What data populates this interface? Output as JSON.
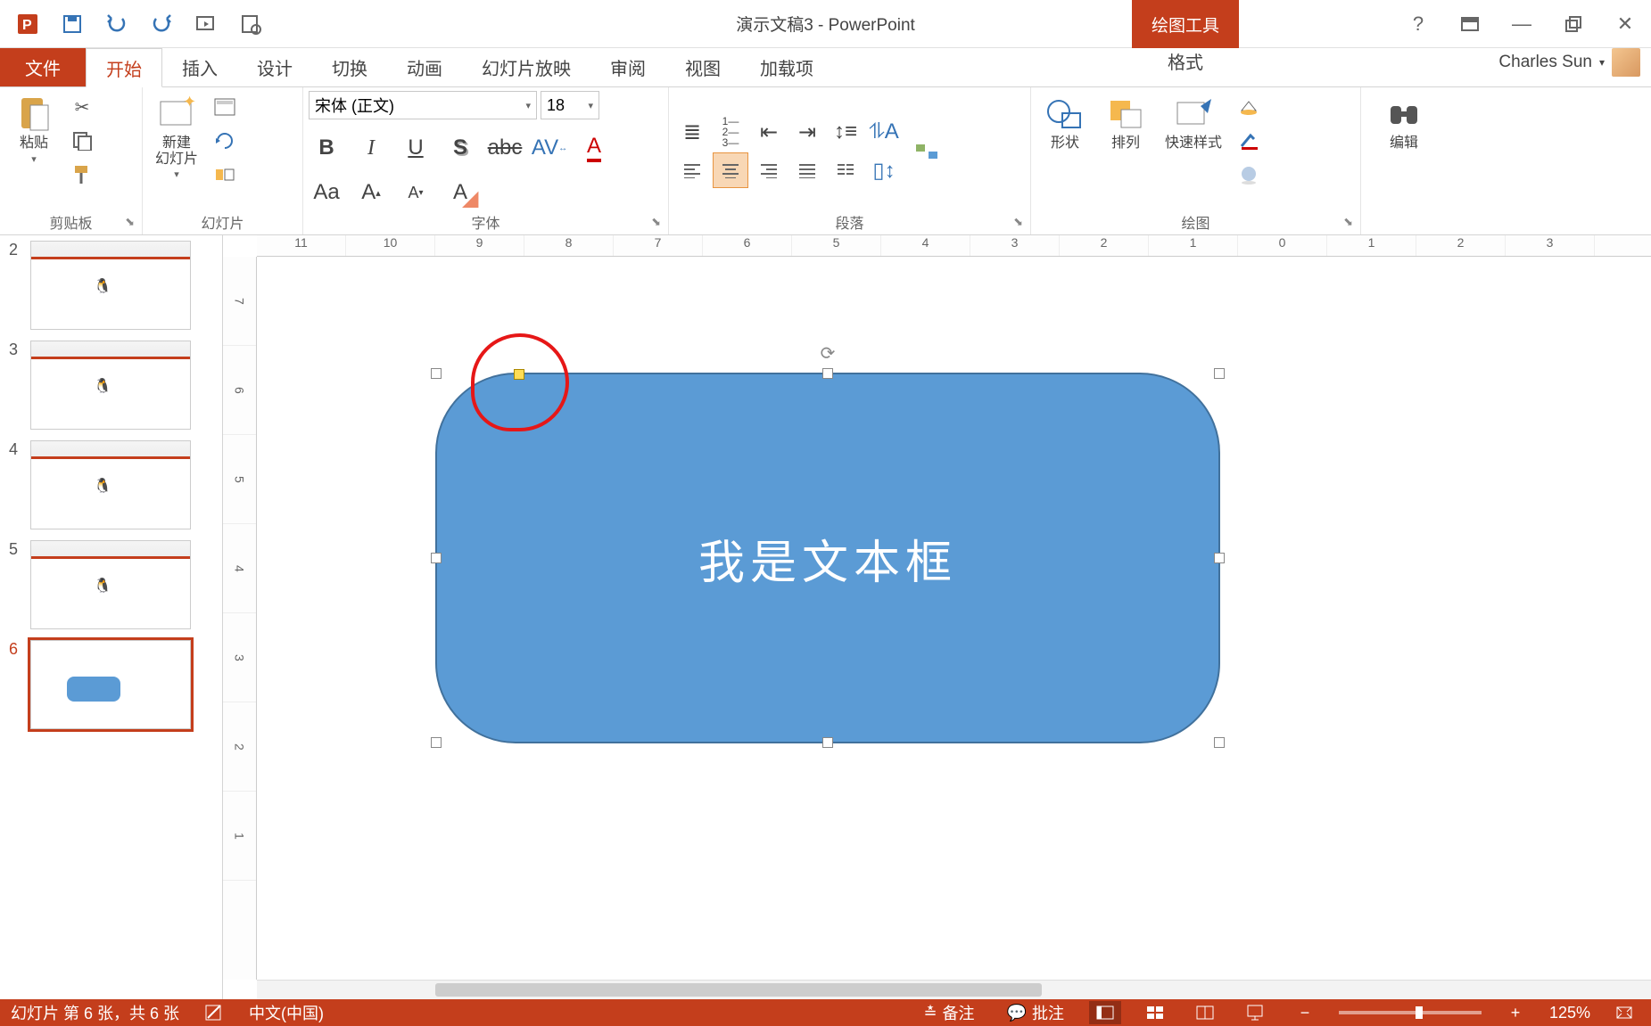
{
  "title": "演示文稿3 - PowerPoint",
  "context_tab": "绘图工具",
  "user_name": "Charles Sun",
  "tabs": {
    "file": "文件",
    "home": "开始",
    "insert": "插入",
    "design": "设计",
    "transitions": "切换",
    "animations": "动画",
    "slideshow": "幻灯片放映",
    "review": "审阅",
    "view": "视图",
    "addins": "加载项",
    "format": "格式"
  },
  "groups": {
    "clipboard": {
      "label": "剪贴板",
      "paste": "粘贴"
    },
    "slides": {
      "label": "幻灯片",
      "new_slide": "新建\n幻灯片"
    },
    "font": {
      "label": "字体",
      "name": "宋体 (正文)",
      "size": "18"
    },
    "paragraph": {
      "label": "段落"
    },
    "drawing": {
      "label": "绘图",
      "shapes": "形状",
      "arrange": "排列",
      "quickstyles": "快速样式"
    },
    "editing": {
      "label": "编辑"
    }
  },
  "ruler_h": [
    "11",
    "10",
    "9",
    "8",
    "7",
    "6",
    "5",
    "4",
    "3",
    "2",
    "1",
    "0",
    "1",
    "2",
    "3"
  ],
  "ruler_v": [
    "7",
    "6",
    "5",
    "4",
    "3",
    "2",
    "1"
  ],
  "slide_thumbs": [
    {
      "num": "2"
    },
    {
      "num": "3"
    },
    {
      "num": "4"
    },
    {
      "num": "5"
    },
    {
      "num": "6",
      "current": true
    }
  ],
  "shape_text": "我是文本框",
  "status": {
    "slide_info": "幻灯片 第 6 张，共 6 张",
    "language": "中文(中国)",
    "notes": "备注",
    "comments": "批注",
    "zoom": "125%"
  },
  "colors": {
    "accent": "#c43e1c",
    "shape_fill": "#5b9bd5",
    "shape_border": "#41719c"
  }
}
